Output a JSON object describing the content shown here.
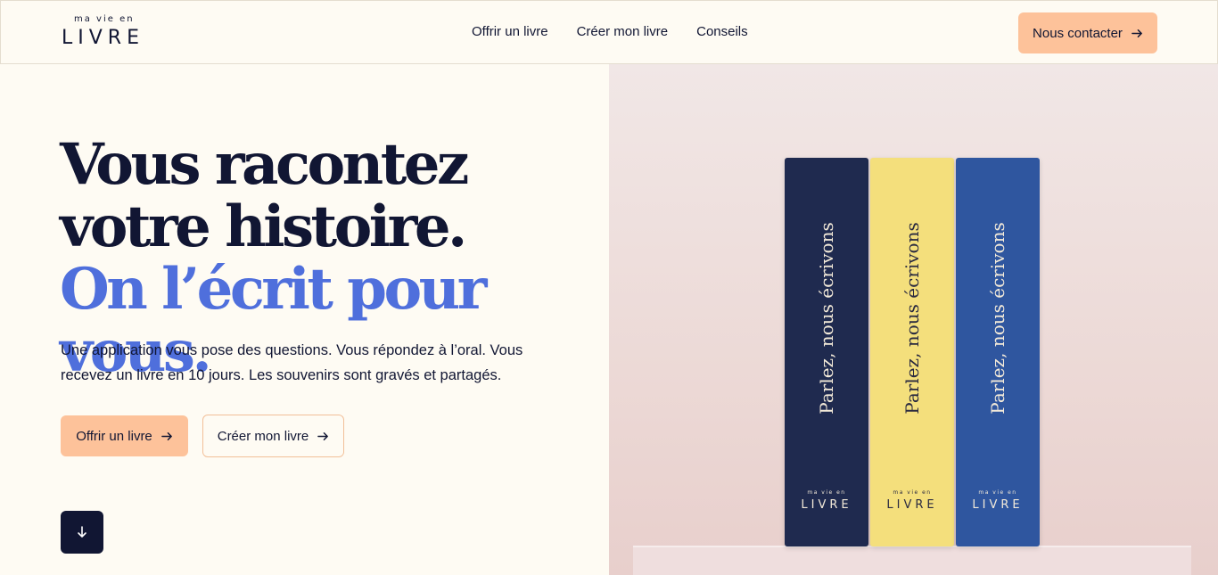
{
  "header": {
    "logo_small": "ma vie en",
    "logo_big": "LIVRE",
    "nav": [
      {
        "label": "Offrir un livre"
      },
      {
        "label": "Créer mon livre"
      },
      {
        "label": "Conseils"
      }
    ],
    "contact_label": "Nous contacter",
    "contact_icon": "arrow-right-icon"
  },
  "hero": {
    "headline_part1": "Vous racontez votre histoire.",
    "headline_part2": "On l’écrit pour vous.",
    "subtitle": "Une application vous pose des questions. Vous répondez à l’oral. Vous recevez un livre en 10 jours. Les souvenirs sont gravés et partagés.",
    "primary_button": "Offrir un livre",
    "secondary_button": "Créer mon livre",
    "scroll_icon": "arrow-down-icon"
  },
  "books": [
    {
      "spine": "Parlez, nous écrivons",
      "brand_small": "ma vie en",
      "brand_big": "LIVRE"
    },
    {
      "spine": "Parlez, nous écrivons",
      "brand_small": "ma vie en",
      "brand_big": "LIVRE"
    },
    {
      "spine": "Parlez, nous écrivons",
      "brand_small": "ma vie en",
      "brand_big": "LIVRE"
    }
  ],
  "colors": {
    "background": "#fefbf3",
    "navy": "#111633",
    "accent_blue": "#4f6fdc",
    "peach": "#fdc29a"
  }
}
